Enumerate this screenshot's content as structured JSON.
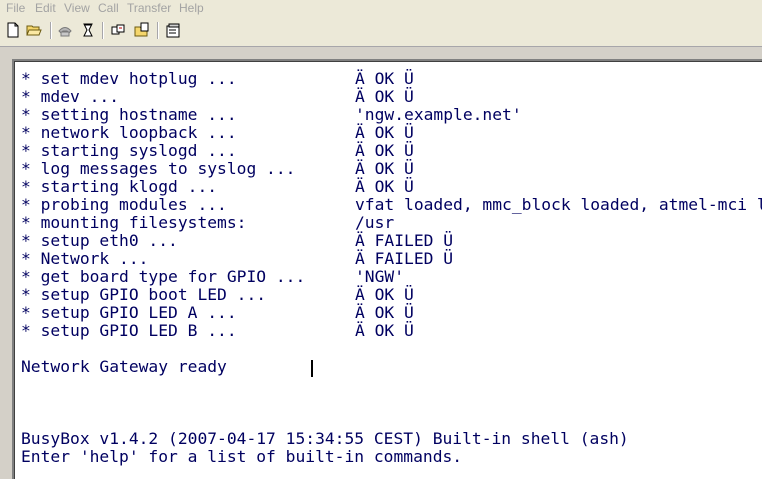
{
  "menu": [
    "File",
    "Edit",
    "View",
    "Call",
    "Transfer",
    "Help"
  ],
  "toolbar": {
    "icons": [
      "new-document-icon",
      "open-folder-icon",
      "phone-icon",
      "hang-up-icon",
      "properties-icon",
      "send-icon",
      "settings-icon"
    ]
  },
  "terminal": {
    "boot_lines": [
      {
        "label": "* set mdev hotplug ...",
        "status": "Ä OK Ü"
      },
      {
        "label": "* mdev ...",
        "status": "Ä OK Ü"
      },
      {
        "label": "* setting hostname ...",
        "status": "'ngw.example.net'"
      },
      {
        "label": "* network loopback ...",
        "status": "Ä OK Ü"
      },
      {
        "label": "* starting syslogd ...",
        "status": "Ä OK Ü"
      },
      {
        "label": "* log messages to syslog ...",
        "status": "Ä OK Ü"
      },
      {
        "label": "* starting klogd ...",
        "status": "Ä OK Ü"
      },
      {
        "label": "* probing modules ...",
        "status": "vfat loaded, mmc_block loaded, atmel-mci l"
      },
      {
        "label": "* mounting filesystems:",
        "status": "/usr"
      },
      {
        "label": "* setup eth0 ...",
        "status": "Ä FAILED Ü"
      },
      {
        "label": "* Network ...",
        "status": "Ä FAILED Ü"
      },
      {
        "label": "* get board type for GPIO ...",
        "status": "'NGW'"
      },
      {
        "label": "* setup GPIO boot LED ...",
        "status": "Ä OK Ü"
      },
      {
        "label": "* setup GPIO LED A ...",
        "status": "Ä OK Ü"
      },
      {
        "label": "* setup GPIO LED B ...",
        "status": "Ä OK Ü"
      }
    ],
    "ready_line": "Network Gateway ready",
    "busybox_line": "BusyBox v1.4.2 (2007-04-17 15:34:55 CEST) Built-in shell (ash)",
    "help_line": "Enter 'help' for a list of built-in commands."
  }
}
